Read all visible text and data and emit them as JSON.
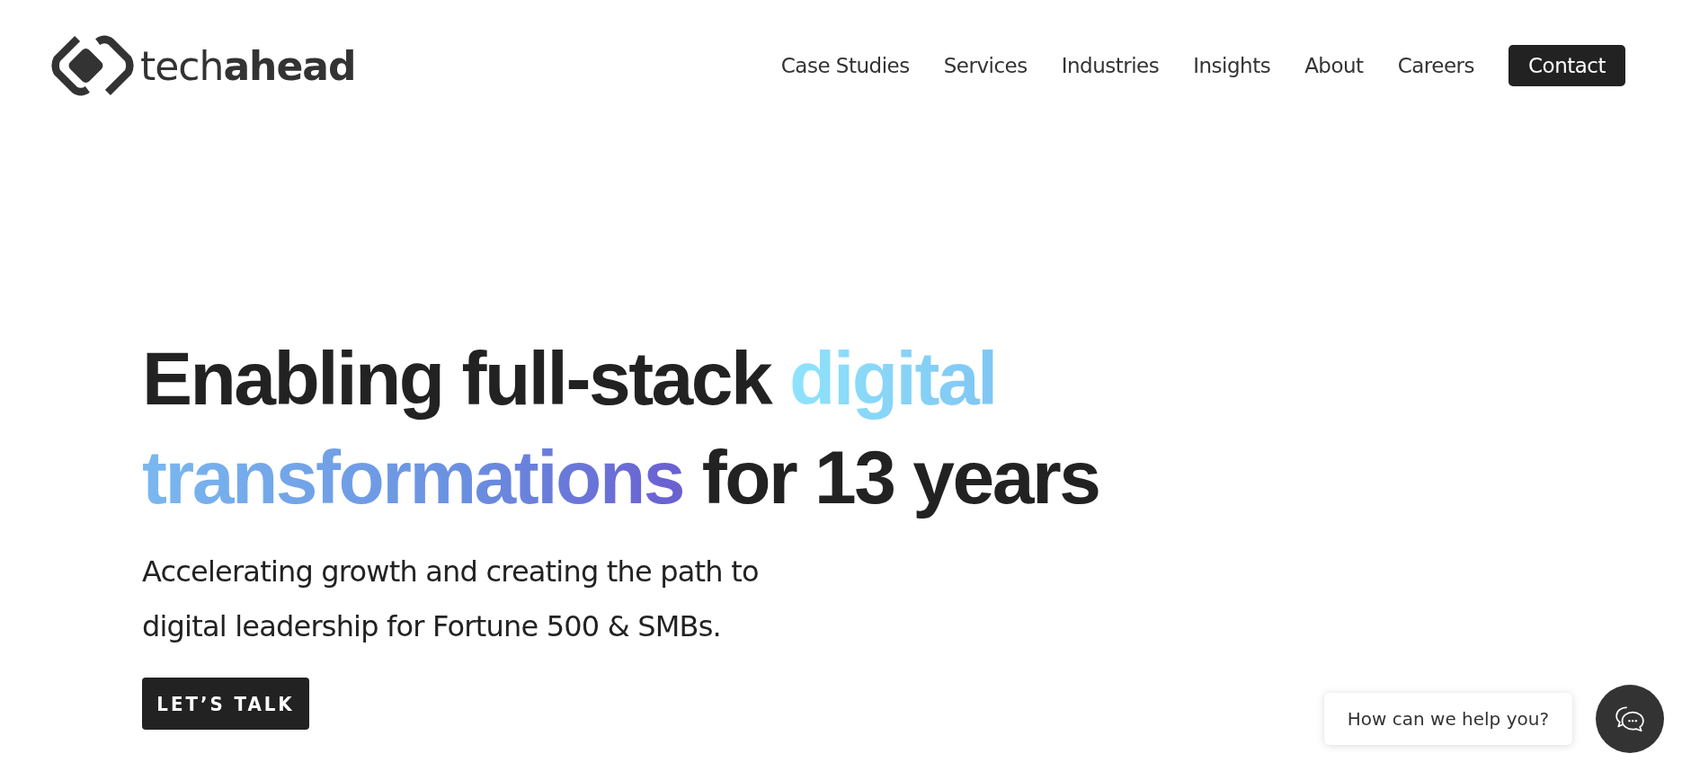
{
  "logo": {
    "text": "tech**ahead**"
  },
  "nav": [
    {
      "label": "Case Studies",
      "kind": "link"
    },
    {
      "label": "Services",
      "kind": "link"
    },
    {
      "label": "Industries",
      "kind": "link"
    },
    {
      "label": "Insights",
      "kind": "link"
    },
    {
      "label": "About",
      "kind": "link"
    },
    {
      "label": "Careers",
      "kind": "link"
    },
    {
      "label": "Contact",
      "kind": "button"
    }
  ],
  "hero": {
    "heading_lines": [
      [
        {
          "text": "Enabling full-stack ",
          "highlight": false
        },
        {
          "text": "digital",
          "highlight": true
        }
      ],
      [
        {
          "text": "transformations",
          "highlight": true
        },
        {
          "text": " for 13 years",
          "highlight": false
        }
      ]
    ],
    "subtitle_lines": [
      "Accelerating growth and creating the path to",
      "digital leadership for Fortune 500 & SMBs."
    ],
    "cta": "LET’S TALK"
  },
  "chat": {
    "prompt": "How can we help you?"
  }
}
